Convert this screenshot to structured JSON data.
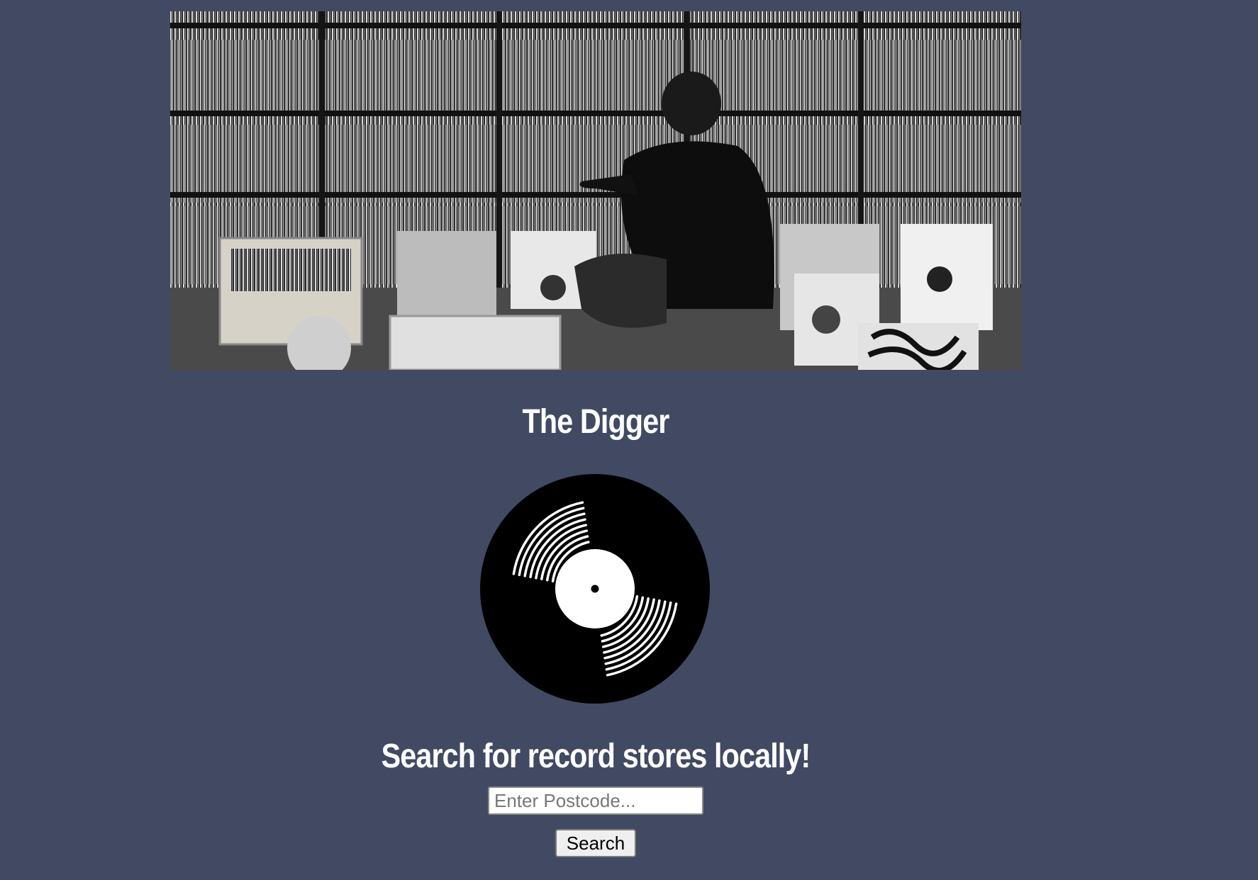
{
  "hero": {
    "image_name": "record-store-digger-photo"
  },
  "header": {
    "title": "The Digger"
  },
  "logo": {
    "icon": "vinyl-record-icon"
  },
  "search": {
    "heading": "Search for record stores locally!",
    "placeholder": "Enter Postcode...",
    "value": "",
    "button_label": "Search"
  },
  "colors": {
    "background": "#414a62",
    "text": "#ffffff",
    "record": "#000000"
  }
}
